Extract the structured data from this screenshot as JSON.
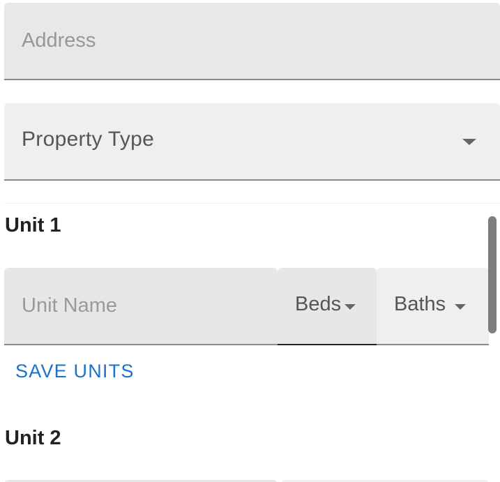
{
  "form": {
    "address": {
      "placeholder": "Address",
      "value": ""
    },
    "property_type": {
      "label": "Property Type",
      "icon": "chevron-down-icon"
    }
  },
  "units": [
    {
      "title": "Unit 1",
      "unit_name": {
        "placeholder": "Unit Name",
        "value": ""
      },
      "beds": {
        "label": "Beds",
        "icon": "chevron-down-icon"
      },
      "baths": {
        "label": "Baths",
        "icon": "chevron-down-icon"
      },
      "save_label": "SAVE UNITS"
    },
    {
      "title": "Unit 2"
    }
  ],
  "colors": {
    "accent": "#1a73c8",
    "field_bg": "#e8e8e8",
    "underline": "#8a8a8a"
  }
}
